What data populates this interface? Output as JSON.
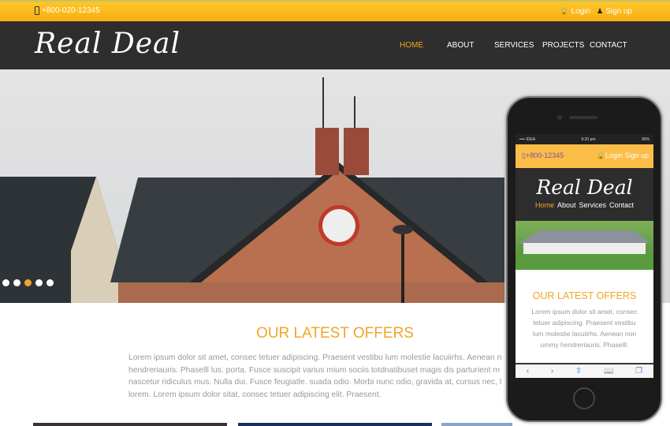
{
  "topbar": {
    "phone": "+800-020-12345",
    "login": "Login",
    "signup": "Sign up"
  },
  "nav": {
    "logo": "Real Deal",
    "items": [
      {
        "label": "HOME",
        "active": true
      },
      {
        "label": "ABOUT"
      },
      {
        "label": "SERVICES"
      },
      {
        "label": "PROJECTS"
      },
      {
        "label": "CONTACT"
      }
    ]
  },
  "hero": {
    "slides": 5,
    "active_slide": 4
  },
  "offers": {
    "title": "OUR LATEST OFFERS",
    "lines": [
      "Lorem ipsum dolor sit amet, consec tetuer adipiscing. Praesent vestibu lum molestie lacuiirhs. Aenean n",
      "hendreriauris. Phaselll lus. porta. Fusce suscipit varius mium sociis totdnatibuset magis dis parturient m",
      "nascetur ridiculus mus. Nulla dui. Fusce feugiatle. suada odio. Morbi nunc odio, gravida at, cursus nec, l",
      "lorem. Lorem ipsum dolor sitat, consec tetuer adipiscing elit. Praesent."
    ]
  },
  "mobile": {
    "status_carrier": "•••• IDEA",
    "status_time": "9:20 pm",
    "status_battery": "90%",
    "phone": "+800-12345",
    "login": "Login",
    "signup": "Sign up",
    "logo": "Real Deal",
    "nav": [
      "Home",
      "About",
      "Services",
      "Contact"
    ],
    "title": "OUR LATEST OFFERS",
    "lines": [
      "Lorem ipsum dolor sit amet, consec",
      "tetuer adipiscing. Praesent vestibu",
      "lum molestie lacuiirhs. Aenean non",
      "ummy hendreriauris. Phaselll."
    ],
    "toolbar": [
      "back",
      "forward",
      "share",
      "bookmarks",
      "tabs"
    ]
  },
  "colors": {
    "accent": "#f2a526",
    "topbar": "#fdbd1e",
    "nav": "#2e2e2e"
  }
}
